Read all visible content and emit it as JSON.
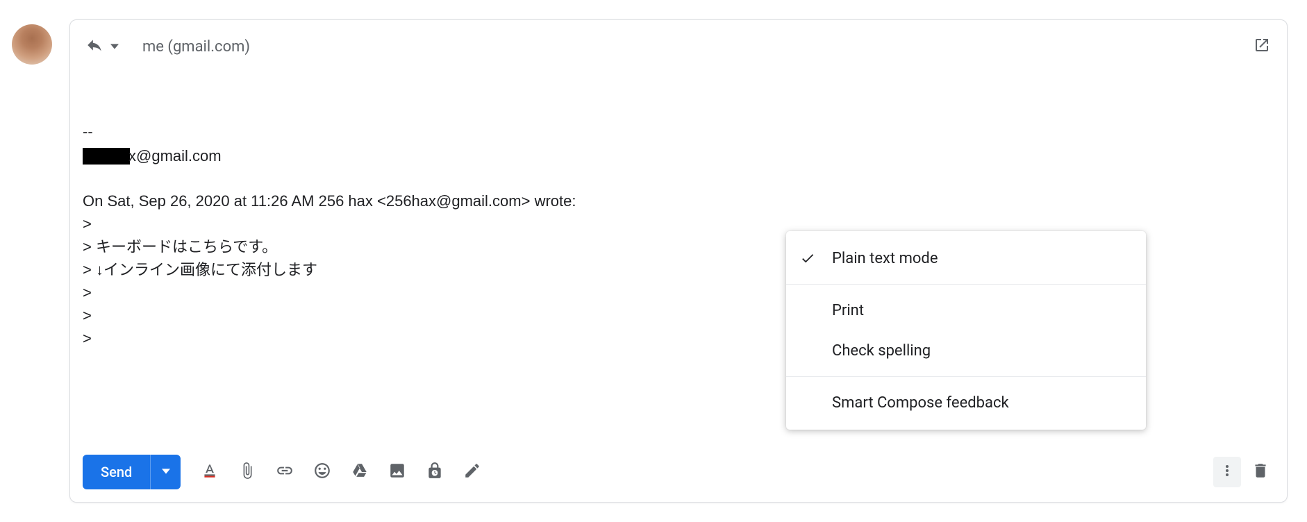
{
  "header": {
    "recipients": "me (gmail.com)"
  },
  "body": {
    "sig_dashes": "--",
    "sig_email_suffix": "x@gmail.com",
    "quote_intro": "On Sat, Sep 26, 2020 at 11:26 AM 256 hax <256hax@gmail.com> wrote:",
    "q1": ">",
    "q2": "> キーボードはこちらです。",
    "q3": "> ↓インライン画像にて添付します",
    "q4": ">",
    "q5": ">",
    "q6": ">"
  },
  "toolbar": {
    "send_label": "Send"
  },
  "menu": {
    "plain_text": "Plain text mode",
    "print": "Print",
    "check_spelling": "Check spelling",
    "smart_compose": "Smart Compose feedback"
  }
}
